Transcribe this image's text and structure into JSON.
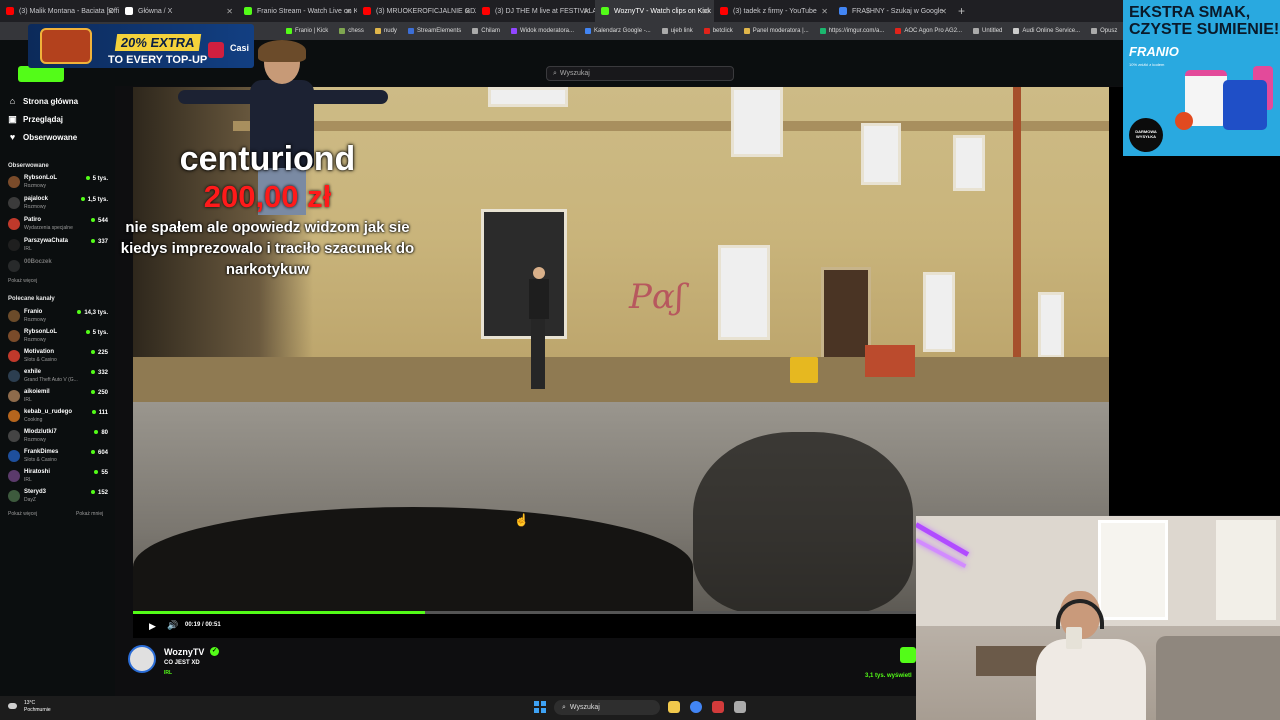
{
  "browser": {
    "tabs": [
      {
        "label": "(3) Malik Montana - Baciata [Official Vi",
        "color": "#ff0000",
        "active": false
      },
      {
        "label": "Główna / X",
        "color": "#ffffff",
        "active": false
      },
      {
        "label": "Franio Stream - Watch Live on Kick",
        "color": "#53fc18",
        "active": false
      },
      {
        "label": "(3) MRUOKEROFICJALNIE GDZIE",
        "color": "#ff0000",
        "active": false
      },
      {
        "label": "(3) DJ THE M live at FESTIVALAR",
        "color": "#ff0000",
        "active": false
      },
      {
        "label": "WoznyTV - Watch clips on Kick",
        "color": "#53fc18",
        "active": true
      },
      {
        "label": "(3) tadek z firmy - YouTube",
        "color": "#ff0000",
        "active": false
      },
      {
        "label": "FRA$HNY - Szukaj w Google",
        "color": "#4285f4",
        "active": false
      }
    ],
    "new_tab": "+",
    "bookmarks": [
      {
        "label": "Franio | Kick",
        "color": "#53fc18"
      },
      {
        "label": "chess",
        "color": "#7fa650"
      },
      {
        "label": "nudy",
        "color": "#e0b64a"
      },
      {
        "label": "StreamElements",
        "color": "#3c6ed6"
      },
      {
        "label": "Chilam",
        "color": "#aaaaaa"
      },
      {
        "label": "Widok moderatora...",
        "color": "#9146ff"
      },
      {
        "label": "Kalendarz Google -...",
        "color": "#4285f4"
      },
      {
        "label": "ujeb link",
        "color": "#aaaaaa"
      },
      {
        "label": "betclick",
        "color": "#e2231a"
      },
      {
        "label": "Panel moderatora |...",
        "color": "#e0b64a"
      },
      {
        "label": "https://imgur.com/a...",
        "color": "#1bb76e"
      },
      {
        "label": "AOC Agon Pro AG2...",
        "color": "#e2231a"
      },
      {
        "label": "Untitled",
        "color": "#aaaaaa"
      },
      {
        "label": "Audi Online Service...",
        "color": "#cccccc"
      },
      {
        "label": "Opusz",
        "color": "#aaaaaa"
      }
    ]
  },
  "promo": {
    "line1": "20% EXTRA",
    "line2": "TO EVERY TOP-UP",
    "casino": "Casi"
  },
  "search": {
    "placeholder": "Wyszukaj"
  },
  "sidebar": {
    "nav": [
      {
        "label": "Strona główna",
        "icon": "home-icon",
        "glyph": "⌂"
      },
      {
        "label": "Przeglądaj",
        "icon": "browse-icon",
        "glyph": "▣"
      },
      {
        "label": "Obserwowane",
        "icon": "heart-icon",
        "glyph": "♥"
      }
    ],
    "followed_title": "Obserwowane",
    "followed": [
      {
        "name": "RybsonLoL",
        "category": "Rozmowy",
        "viewers": "5 tys.",
        "color": "#7a4b2a",
        "online": true
      },
      {
        "name": "pajalock",
        "category": "Rozmowy",
        "viewers": "1,5 tys.",
        "color": "#3b3b3b",
        "online": true
      },
      {
        "name": "Patiro",
        "category": "Wydarzenia specjalne",
        "viewers": "544",
        "color": "#c0392b",
        "online": true
      },
      {
        "name": "ParszywaChata",
        "category": "IRL",
        "viewers": "337",
        "color": "#1f1f1f",
        "online": true
      },
      {
        "name": "00Boczek",
        "category": "",
        "viewers": "",
        "color": "#555555",
        "online": false
      }
    ],
    "followed_more": "Pokaż więcej",
    "recommended_title": "Polecane kanały",
    "recommended": [
      {
        "name": "Franio",
        "category": "Rozmowy",
        "viewers": "14,3 tys.",
        "color": "#6b4b2a"
      },
      {
        "name": "RybsonLoL",
        "category": "Rozmowy",
        "viewers": "5 tys.",
        "color": "#7a4b2a"
      },
      {
        "name": "Motivation",
        "category": "Slots & Casino",
        "viewers": "225",
        "color": "#c0392b"
      },
      {
        "name": "exhile",
        "category": "Grand Theft Auto V (G...",
        "viewers": "332",
        "color": "#2c3e50"
      },
      {
        "name": "aikoiemil",
        "category": "IRL",
        "viewers": "250",
        "color": "#8e6b4b"
      },
      {
        "name": "kebab_u_rudego",
        "category": "Cooking",
        "viewers": "111",
        "color": "#b5651d"
      },
      {
        "name": "Mlodzlutki7",
        "category": "Rozmowy",
        "viewers": "80",
        "color": "#444444"
      },
      {
        "name": "FrankDimes",
        "category": "Slots & Casino",
        "viewers": "604",
        "color": "#1e4f9c"
      },
      {
        "name": "Hiratoshi",
        "category": "IRL",
        "viewers": "55",
        "color": "#5b3a6b"
      },
      {
        "name": "Steryd3",
        "category": "DayZ",
        "viewers": "152",
        "color": "#3d5a3d"
      }
    ],
    "more": "Pokaż więcej",
    "less": "Pokaż mniej"
  },
  "donation": {
    "name": "centuriond",
    "amount": "200,00 zł",
    "message": "nie spałem ale opowiedz widzom jak sie kiedys imprezowalo i traciło szacunek do narkotykuw"
  },
  "player": {
    "time": "00:19 / 00:51",
    "progress": 0.373,
    "play_icon": "▶",
    "volume_icon": "🔊"
  },
  "channel": {
    "name": "WoznyTV",
    "title": "CO JEST XD",
    "category": "IRL",
    "views": "3,1 tys. wyświetl"
  },
  "ad": {
    "headline1": "EKSTRA SMAK,",
    "headline2": "CZYSTE SUMIENIE!",
    "brand": "FRANIO",
    "sub": "10% zniżki z kodem",
    "badge": "DARMOWA WYSYŁKA"
  },
  "taskbar": {
    "weather_temp": "13°C",
    "weather_desc": "Pochmurnie",
    "search": "Wyszukaj"
  }
}
